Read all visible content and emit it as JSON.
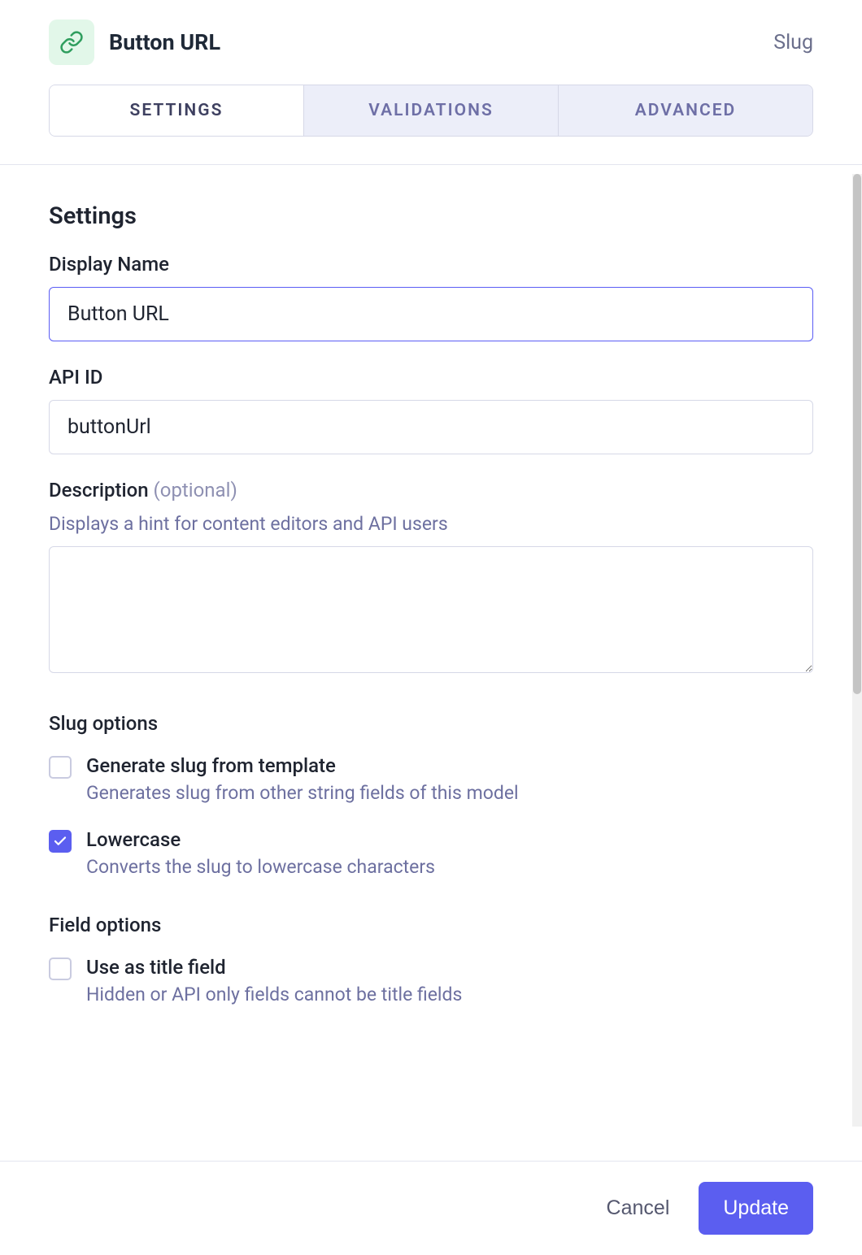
{
  "header": {
    "title": "Button URL",
    "type_label": "Slug",
    "icon": "link-icon"
  },
  "tabs": [
    {
      "label": "SETTINGS",
      "active": true
    },
    {
      "label": "VALIDATIONS",
      "active": false
    },
    {
      "label": "ADVANCED",
      "active": false
    }
  ],
  "section": {
    "title": "Settings"
  },
  "fields": {
    "display_name": {
      "label": "Display Name",
      "value": "Button URL"
    },
    "api_id": {
      "label": "API ID",
      "value": "buttonUrl"
    },
    "description": {
      "label": "Description",
      "optional": "(optional)",
      "hint": "Displays a hint for content editors and API users",
      "value": ""
    }
  },
  "slug_options": {
    "title": "Slug options",
    "items": [
      {
        "label": "Generate slug from template",
        "description": "Generates slug from other string fields of this model",
        "checked": false
      },
      {
        "label": "Lowercase",
        "description": "Converts the slug to lowercase characters",
        "checked": true
      }
    ]
  },
  "field_options": {
    "title": "Field options",
    "items": [
      {
        "label": "Use as title field",
        "description": "Hidden or API only fields cannot be title fields",
        "checked": false
      }
    ]
  },
  "footer": {
    "cancel": "Cancel",
    "submit": "Update"
  },
  "colors": {
    "primary": "#5b5ef0",
    "icon_bg": "#e2f7e9",
    "icon_stroke": "#2f9e5e"
  }
}
